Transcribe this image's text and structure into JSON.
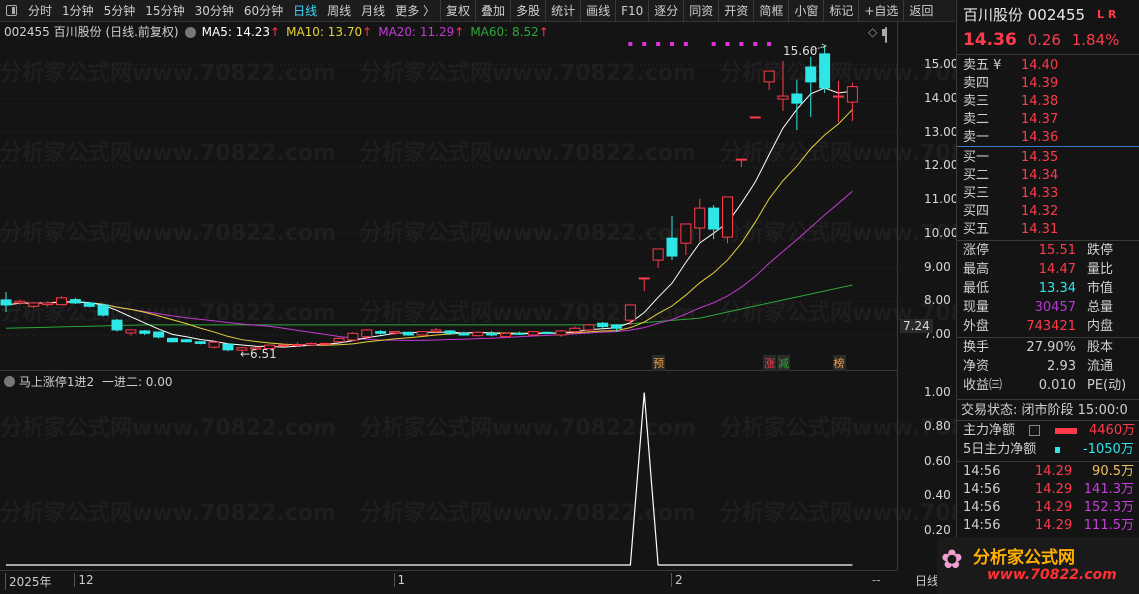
{
  "toolbar": {
    "items": [
      "分时",
      "1分钟",
      "5分钟",
      "15分钟",
      "30分钟",
      "60分钟",
      "日线",
      "周线",
      "月线",
      "更多 〉",
      "复权",
      "叠加",
      "多股",
      "统计",
      "画线",
      "F10",
      "逐分",
      "同资",
      "开资",
      "简框",
      "小窗",
      "标记",
      "+自选",
      "返回"
    ],
    "active": "日线"
  },
  "info": {
    "title": "002455 百川股份 (日线.前复权)",
    "ma5": "MA5: 14.23",
    "ma10": "MA10: 13.70",
    "ma20": "MA20: 11.29",
    "ma60": "MA60: 8.52",
    "arrow": "↑"
  },
  "colors": {
    "up": "#ff3b4b",
    "down": "#2fe6e6",
    "ma5": "#ffffff",
    "ma10": "#e6d23c",
    "ma20": "#c43ad4",
    "ma60": "#2ea838",
    "signal_dot": "#e030e0"
  },
  "chart_data": {
    "type": "candlestick",
    "ylim": [
      6.3,
      15.6
    ],
    "yticks": [
      "15.00",
      "14.00",
      "13.00",
      "12.00",
      "11.00",
      "10.00",
      "9.00",
      "8.00",
      "7.00"
    ],
    "ytick_values": [
      15,
      14,
      13,
      12,
      11,
      10,
      9,
      8,
      7
    ],
    "crosshair_price": "7.24",
    "ohlc": [
      [
        8.04,
        8.27,
        7.68,
        7.89
      ],
      [
        7.95,
        8.05,
        7.9,
        8.0
      ],
      [
        7.85,
        7.98,
        7.8,
        7.95
      ],
      [
        7.9,
        8.0,
        7.85,
        7.95
      ],
      [
        7.9,
        8.15,
        7.88,
        8.1
      ],
      [
        8.05,
        8.1,
        7.92,
        7.95
      ],
      [
        7.95,
        7.98,
        7.82,
        7.85
      ],
      [
        7.89,
        7.92,
        7.55,
        7.59
      ],
      [
        7.44,
        7.48,
        7.1,
        7.15
      ],
      [
        7.06,
        7.15,
        6.98,
        7.15
      ],
      [
        7.12,
        7.15,
        7.0,
        7.05
      ],
      [
        7.09,
        7.1,
        6.9,
        6.94
      ],
      [
        6.9,
        6.92,
        6.78,
        6.8
      ],
      [
        6.86,
        6.88,
        6.78,
        6.8
      ],
      [
        6.8,
        6.82,
        6.72,
        6.75
      ],
      [
        6.64,
        6.82,
        6.6,
        6.79
      ],
      [
        6.73,
        6.75,
        6.52,
        6.56
      ],
      [
        6.55,
        6.65,
        6.51,
        6.62
      ],
      [
        6.58,
        6.65,
        6.55,
        6.62
      ],
      [
        6.6,
        6.72,
        6.58,
        6.7
      ],
      [
        6.68,
        6.74,
        6.65,
        6.7
      ],
      [
        6.72,
        6.78,
        6.66,
        6.72
      ],
      [
        6.7,
        6.78,
        6.68,
        6.75
      ],
      [
        6.72,
        6.78,
        6.7,
        6.75
      ],
      [
        6.8,
        6.92,
        6.78,
        6.9
      ],
      [
        6.85,
        7.08,
        6.82,
        7.05
      ],
      [
        6.95,
        7.18,
        6.9,
        7.15
      ],
      [
        7.1,
        7.15,
        7.02,
        7.05
      ],
      [
        7.06,
        7.12,
        7.0,
        7.1
      ],
      [
        7.08,
        7.1,
        6.98,
        7.0
      ],
      [
        7.0,
        7.12,
        6.98,
        7.1
      ],
      [
        7.1,
        7.2,
        7.05,
        7.15
      ],
      [
        7.12,
        7.15,
        7.0,
        7.05
      ],
      [
        7.05,
        7.1,
        6.98,
        7.0
      ],
      [
        6.98,
        7.1,
        6.95,
        7.08
      ],
      [
        7.05,
        7.12,
        6.96,
        7.0
      ],
      [
        6.95,
        7.08,
        6.92,
        7.05
      ],
      [
        7.05,
        7.1,
        7.0,
        7.02
      ],
      [
        7.0,
        7.12,
        6.98,
        7.1
      ],
      [
        7.08,
        7.1,
        7.02,
        7.05
      ],
      [
        7.0,
        7.15,
        6.95,
        7.12
      ],
      [
        7.1,
        7.25,
        7.05,
        7.2
      ],
      [
        7.15,
        7.32,
        7.1,
        7.3
      ],
      [
        7.35,
        7.38,
        7.2,
        7.25
      ],
      [
        7.3,
        7.32,
        7.1,
        7.2
      ],
      [
        7.44,
        7.89,
        7.3,
        7.89
      ],
      [
        8.69,
        8.69,
        8.3,
        8.69
      ],
      [
        9.22,
        9.55,
        8.99,
        9.55
      ],
      [
        9.87,
        10.53,
        9.22,
        9.34
      ],
      [
        9.72,
        10.29,
        9.37,
        10.29
      ],
      [
        10.17,
        11.03,
        9.76,
        10.76
      ],
      [
        10.76,
        10.85,
        9.84,
        10.14
      ],
      [
        9.9,
        11.09,
        9.72,
        11.09
      ],
      [
        12.21,
        12.21,
        11.98,
        12.21
      ],
      [
        13.46,
        13.46,
        13.46,
        13.46
      ],
      [
        14.5,
        14.82,
        14.26,
        14.82
      ],
      [
        13.99,
        15.12,
        13.64,
        14.08
      ],
      [
        14.14,
        14.56,
        13.07,
        13.87
      ],
      [
        14.94,
        15.24,
        13.46,
        14.5
      ],
      [
        15.33,
        15.6,
        14.17,
        14.32
      ],
      [
        14.05,
        14.53,
        13.31,
        14.08
      ],
      [
        13.9,
        14.47,
        13.34,
        14.36
      ]
    ],
    "ma60_points": [
      [
        0,
        7.2
      ],
      [
        10,
        7.3
      ],
      [
        30,
        7.3
      ],
      [
        44,
        7.3
      ],
      [
        50,
        7.5
      ],
      [
        55,
        7.95
      ],
      [
        61,
        8.48
      ]
    ],
    "high_label": "15.60",
    "low_label": "←6.51",
    "signal_dot_indices": [
      45,
      46,
      47,
      48,
      49,
      51,
      52,
      53,
      54,
      55
    ],
    "markers": [
      {
        "index": 47,
        "text": "预",
        "color": "#f0a040"
      },
      {
        "index": 55,
        "text": "涨",
        "color": "#ff3b4b"
      },
      {
        "index": 56,
        "text": "减",
        "color": "#2ea838"
      },
      {
        "index": 60,
        "text": "榜",
        "color": "#f0a040"
      }
    ],
    "date_labels": [
      {
        "index": 0,
        "text": "2025年"
      },
      {
        "index": 5,
        "text": "12"
      },
      {
        "index": 28,
        "text": "1"
      },
      {
        "index": 48,
        "text": "2"
      }
    ],
    "indicator": {
      "title": "马上涨停1进2",
      "value_label": "一进二: 0.00",
      "yticks": [
        "1.00",
        "0.80",
        "0.60",
        "0.40",
        "0.20"
      ],
      "ytick_values": [
        1,
        0.8,
        0.6,
        0.4,
        0.2
      ],
      "spike_index": 46
    }
  },
  "date_bar": {
    "dash": "--",
    "period": "日线"
  },
  "right": {
    "title": "百川股份 002455",
    "lr": "L R",
    "price": "14.36",
    "change": "0.26",
    "pct": "1.84%",
    "sell": [
      {
        "label": "卖五 ¥",
        "price": "14.40"
      },
      {
        "label": "卖四",
        "price": "14.39"
      },
      {
        "label": "卖三",
        "price": "14.38"
      },
      {
        "label": "卖二",
        "price": "14.37"
      },
      {
        "label": "卖一",
        "price": "14.36"
      }
    ],
    "buy": [
      {
        "label": "买一",
        "price": "14.35"
      },
      {
        "label": "买二",
        "price": "14.34"
      },
      {
        "label": "买三",
        "price": "14.33"
      },
      {
        "label": "买四",
        "price": "14.32"
      },
      {
        "label": "买五",
        "price": "14.31"
      }
    ],
    "stats": [
      {
        "l": "涨停",
        "v": "15.51",
        "r": "跌停",
        "c": "red"
      },
      {
        "l": "最高",
        "v": "14.47",
        "r": "量比",
        "c": "red"
      },
      {
        "l": "最低",
        "v": "13.34",
        "r": "市值",
        "c": "cyan"
      },
      {
        "l": "现量",
        "v": "30457",
        "r": "总量",
        "c": "purple"
      },
      {
        "l": "外盘",
        "v": "743421",
        "r": "内盘",
        "c": "red"
      }
    ],
    "stats2": [
      {
        "l": "换手",
        "v": "27.90%",
        "r": "股本"
      },
      {
        "l": "净资",
        "v": "2.93",
        "r": "流通"
      },
      {
        "l": "收益㈢",
        "v": "0.010",
        "r": "PE(动)"
      }
    ],
    "status": "交易状态: 闭市阶段 15:00:0",
    "main_force": {
      "label": "主力净额",
      "value": "4460万"
    },
    "main_force5": {
      "label": "5日主力净额",
      "value": "-1050万"
    },
    "ticks": [
      {
        "t": "14:56",
        "p": "14.29",
        "v": "90.5万",
        "c": "gold"
      },
      {
        "t": "14:56",
        "p": "14.29",
        "v": "141.3万",
        "c": "mag"
      },
      {
        "t": "14:56",
        "p": "14.29",
        "v": "152.3万",
        "c": "mag"
      },
      {
        "t": "14:56",
        "p": "14.29",
        "v": "111.5万",
        "c": "mag"
      }
    ]
  },
  "watermark": {
    "text": "分析家公式网www.70822.com",
    "logo": "分析家公式网",
    "logo_url": "www.70822.com"
  }
}
